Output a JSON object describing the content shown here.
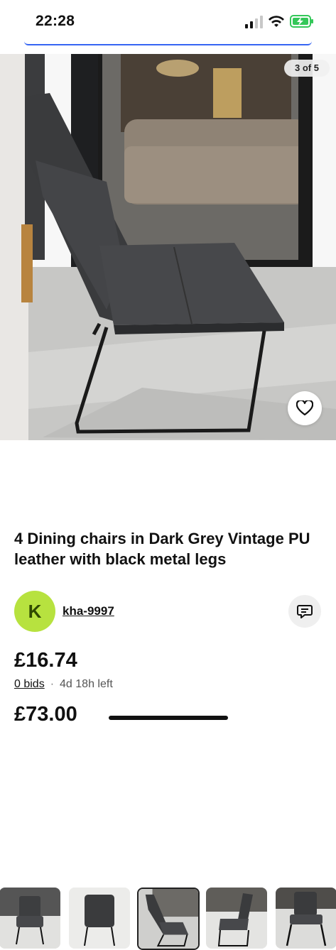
{
  "status_bar": {
    "time": "22:28"
  },
  "gallery": {
    "counter": "3 of 5",
    "thumbnails": [
      {
        "label": "chair-front-view",
        "selected": false
      },
      {
        "label": "chair-back-view",
        "selected": false
      },
      {
        "label": "chair-side-view",
        "selected": true
      },
      {
        "label": "chair-side-view-2",
        "selected": false
      },
      {
        "label": "chair-front-view-2",
        "selected": false
      }
    ]
  },
  "listing": {
    "title": "4 Dining chairs in Dark Grey Vintage PU leather with black metal legs",
    "seller": {
      "initial": "K",
      "username": "kha-9997"
    },
    "current_price": "£16.74",
    "bids": "0 bids",
    "time_left": "4d 18h left",
    "buy_now_price": "£73.00"
  },
  "icons": {
    "watch": "heart-icon",
    "message": "message-icon",
    "signal": "cellular-signal-icon",
    "wifi": "wifi-icon",
    "battery": "battery-charging-icon"
  },
  "colors": {
    "accent": "#3665f3",
    "avatar_bg": "#b7e23f",
    "battery": "#34c759"
  }
}
